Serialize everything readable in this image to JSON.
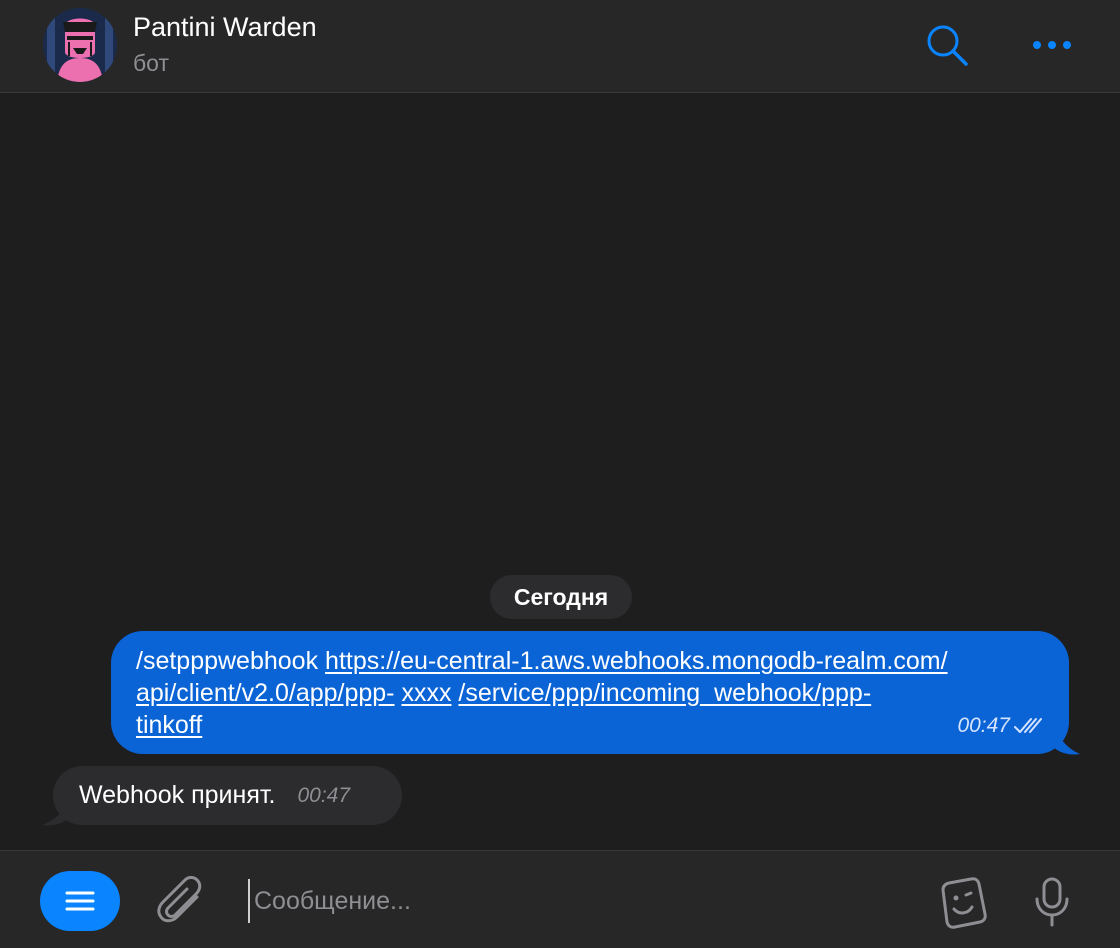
{
  "header": {
    "title": "Pantini Warden",
    "subtitle": "бот"
  },
  "chat": {
    "date_label": "Сегодня",
    "outgoing": {
      "command": "/setpppwebhook",
      "link_part1": "https://eu-central-1.aws.webhooks.mongodb-realm.com/",
      "link_part2": "api/client/v2.0/app/ppp-",
      "link_part3": "xxxx",
      "link_part4": "/service/ppp/incoming_webhook/ppp-",
      "link_part5": "tinkoff",
      "time": "00:47",
      "status": "read"
    },
    "incoming": {
      "text": "Webhook принят.",
      "time": "00:47"
    }
  },
  "input": {
    "placeholder": "Сообщение..."
  },
  "colors": {
    "accent": "#0a84ff",
    "outgoing_bubble": "#0a64d6",
    "incoming_bubble": "#2c2c2e",
    "background": "#1e1e1e",
    "bar": "#272727"
  },
  "icons": {
    "search": "search-icon",
    "more": "more-icon",
    "menu": "menu-icon",
    "attach": "paperclip-icon",
    "sticker": "sticker-icon",
    "mic": "microphone-icon",
    "read": "double-check-icon"
  }
}
